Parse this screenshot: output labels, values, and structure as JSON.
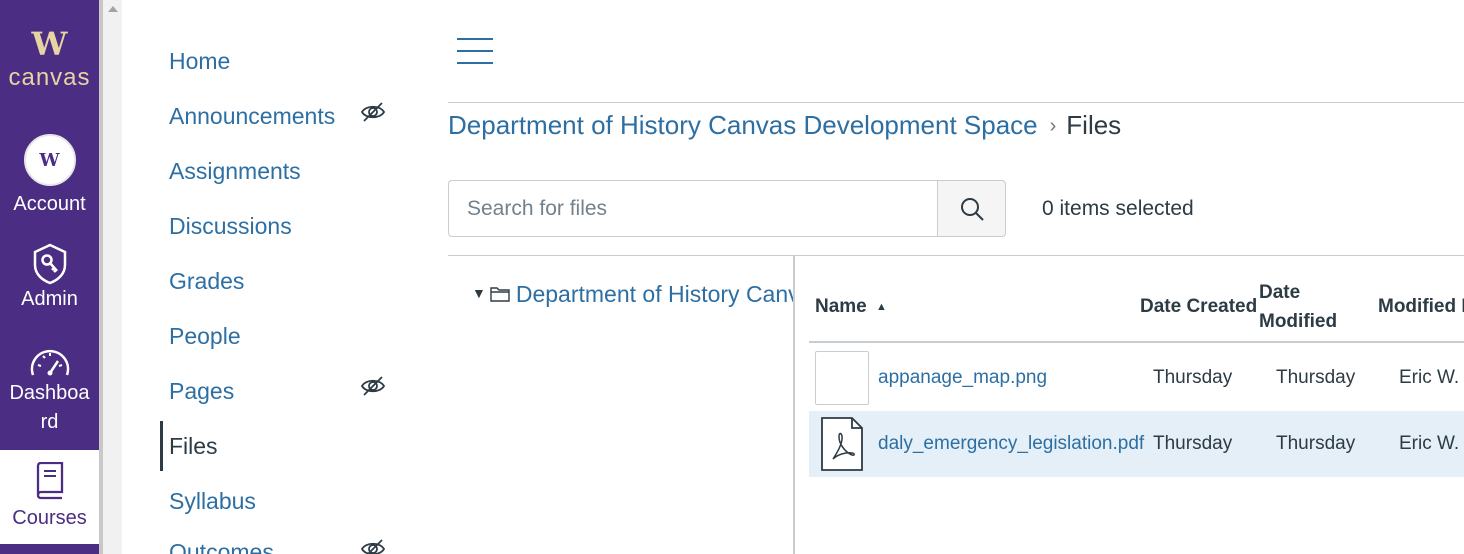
{
  "global_nav": {
    "logo_mark": "W",
    "logo_text": "canvas",
    "avatar_initial": "W",
    "items": [
      {
        "label": "Account",
        "icon": "avatar-icon"
      },
      {
        "label": "Admin",
        "icon": "shield-key-icon"
      },
      {
        "label": "Dashboa\nrd",
        "icon": "dashboard-gauge-icon"
      },
      {
        "label": "Courses",
        "icon": "book-icon"
      }
    ]
  },
  "course_nav": {
    "items": [
      {
        "label": "Home",
        "hidden": false
      },
      {
        "label": "Announcements",
        "hidden": true
      },
      {
        "label": "Assignments",
        "hidden": false
      },
      {
        "label": "Discussions",
        "hidden": false
      },
      {
        "label": "Grades",
        "hidden": false
      },
      {
        "label": "People",
        "hidden": false
      },
      {
        "label": "Pages",
        "hidden": true
      },
      {
        "label": "Files",
        "hidden": false,
        "active": true
      },
      {
        "label": "Syllabus",
        "hidden": false
      },
      {
        "label": "Outcomes",
        "hidden": true
      }
    ]
  },
  "breadcrumb": {
    "course": "Department of History Canvas Development Space",
    "separator": "›",
    "current": "Files"
  },
  "search": {
    "placeholder": "Search for files",
    "value": ""
  },
  "selection": {
    "status": "0 items selected"
  },
  "folder_tree": {
    "root_label": "Department of History Canvas Development Space"
  },
  "file_table": {
    "columns": {
      "name": "Name",
      "sort_indicator": "▲",
      "date_created": "Date Created",
      "date_modified_line1": "Date",
      "date_modified_line2": "Modified",
      "modified_by": "Modified By"
    },
    "rows": [
      {
        "name": "appanage_map.png",
        "date_created": "Thursday",
        "date_modified": "Thursday",
        "modified_by": "Eric W. Ja",
        "icon": "image-thumbnail",
        "selected": false
      },
      {
        "name": "daly_emergency_legislation.pdf",
        "date_created": "Thursday",
        "date_modified": "Thursday",
        "modified_by": "Eric W. Ja",
        "icon": "pdf-file-icon",
        "selected": true
      }
    ]
  },
  "colors": {
    "global_nav_bg": "#4b2e83",
    "logo_gold": "#e8d3a2",
    "link_blue": "#2d6fa3",
    "text_dark": "#2d3b45",
    "selected_row_bg": "#e4eff7",
    "border": "#c7cdd1"
  }
}
